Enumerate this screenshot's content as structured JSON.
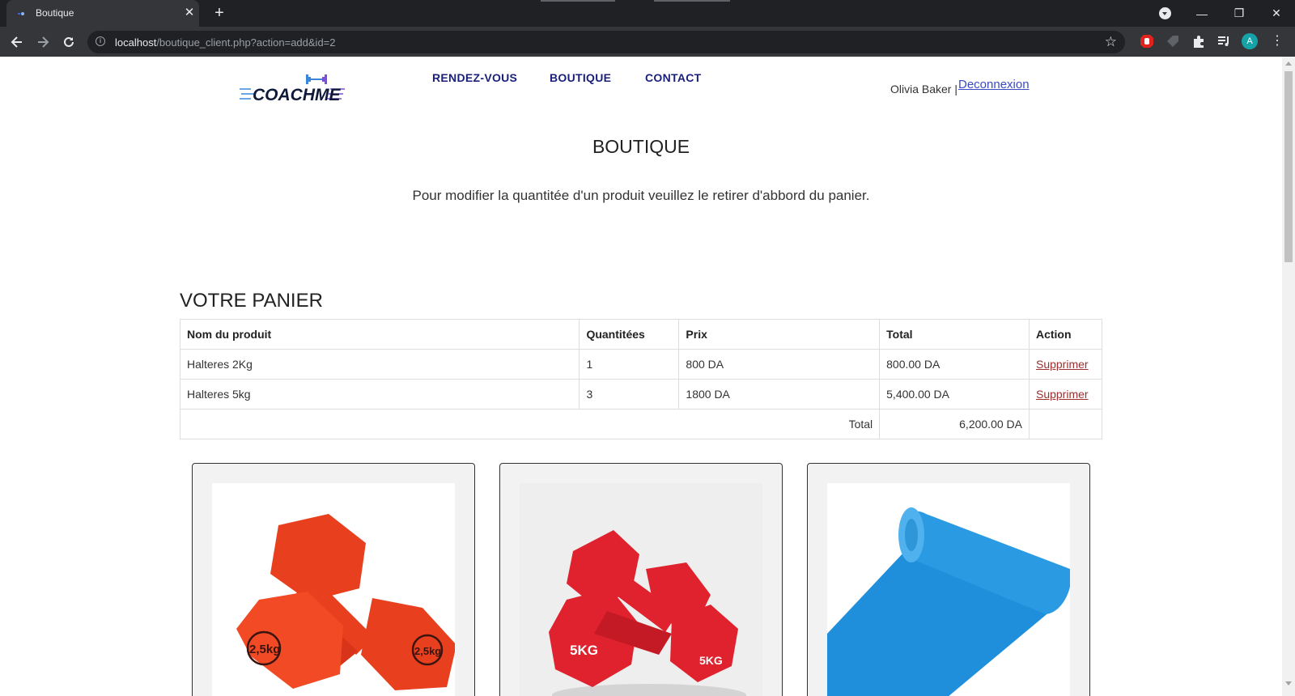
{
  "browser": {
    "tab_title": "Boutique",
    "url_host": "localhost",
    "url_path": "/boutique_client.php?action=add&id=2",
    "avatar_letter": "A",
    "colors": {
      "frame": "#202124",
      "toolbar": "#35363a",
      "avatar": "#15a3a8"
    }
  },
  "header": {
    "logo_text": "COACHME",
    "nav": [
      "RENDEZ-VOUS",
      "BOUTIQUE",
      "CONTACT"
    ],
    "user_name": "Olivia Baker |",
    "logout_label": "Deconnexion"
  },
  "main": {
    "title": "BOUTIQUE",
    "info": "Pour modifier la quantitée d'un produit veuillez le retirer d'abbord du panier.",
    "cart_heading": "VOTRE PANIER",
    "cart": {
      "columns": [
        "Nom du produit",
        "Quantitées",
        "Prix",
        "Total",
        "Action"
      ],
      "rows": [
        {
          "name": "Halteres 2Kg",
          "qty": "1",
          "price": "800 DA",
          "total": "800.00 DA",
          "action": "Supprimer"
        },
        {
          "name": "Halteres 5kg",
          "qty": "3",
          "price": "1800 DA",
          "total": "5,400.00 DA",
          "action": "Supprimer"
        }
      ],
      "total_label": "Total",
      "total_value": "6,200.00 DA"
    },
    "products": [
      {
        "image": "red-dumbbells-2.5kg",
        "label_left": "2,5kg",
        "label_right": "2,5kg"
      },
      {
        "image": "red-dumbbells-5kg",
        "label_left": "5KG",
        "label_right": "5KG"
      },
      {
        "image": "blue-yoga-mat"
      }
    ]
  }
}
